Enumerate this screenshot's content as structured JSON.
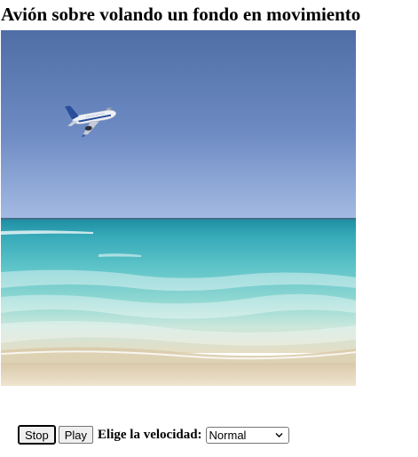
{
  "page": {
    "title": "Avión sobre volando un fondo en movimiento"
  },
  "controls": {
    "stop_label": "Stop",
    "play_label": "Play",
    "speed_label": "Elige la velocidad:",
    "speed_selected": "Normal"
  },
  "icons": {
    "dropdown": "chevron-down-icon",
    "plane": "airplane-icon"
  },
  "colors": {
    "sky_top": "#4f6fa6",
    "sky_bottom": "#9eb3dc",
    "sea_deep": "#2f9fb1",
    "sea_light": "#7ad2d4",
    "sand": "#e9dcc4"
  }
}
